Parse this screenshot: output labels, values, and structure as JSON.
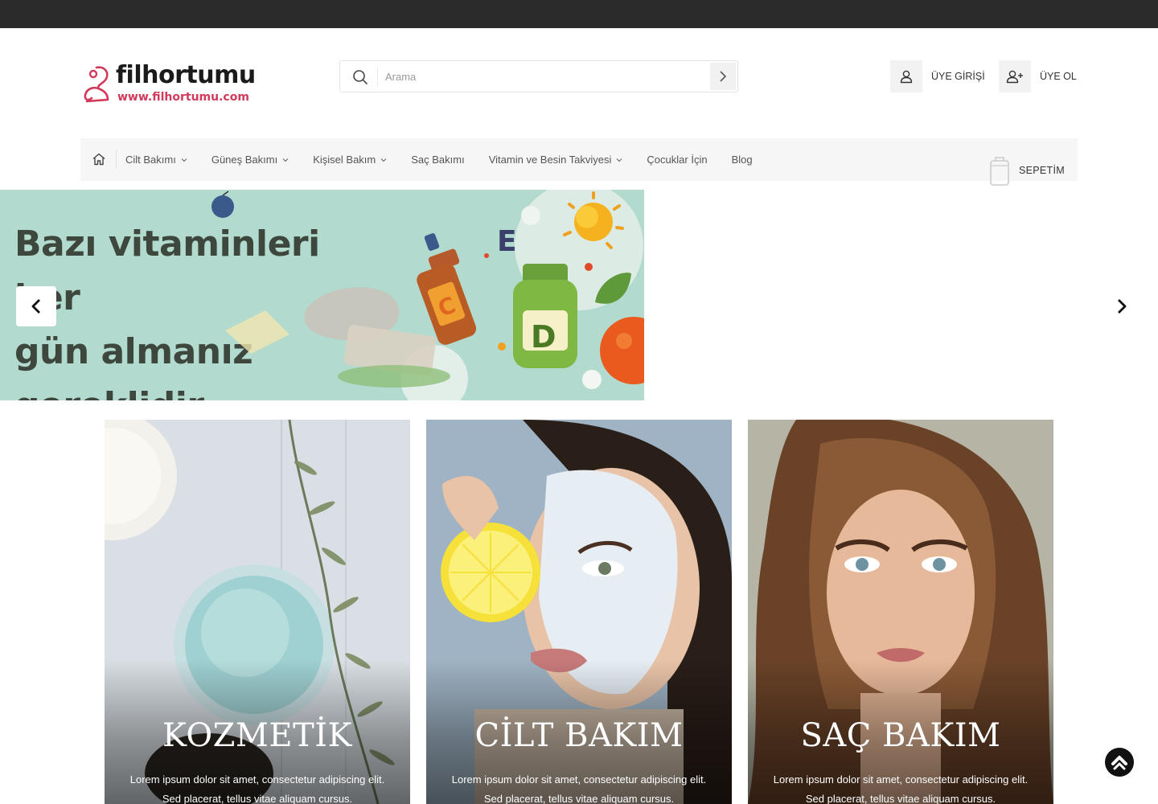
{
  "brand": {
    "name": "filhortumu",
    "url": "www.filhortumu.com",
    "color": "#d23a5c"
  },
  "search": {
    "placeholder": "Arama",
    "icon": "search-icon",
    "submit_icon": "chevron-right-icon"
  },
  "account": {
    "login_label": "ÜYE GİRİŞİ",
    "register_label": "ÜYE OL",
    "login_icon": "user-icon",
    "register_icon": "user-plus-icon"
  },
  "nav": {
    "home_icon": "home-icon",
    "items": [
      {
        "label": "Cilt Bakımı",
        "dropdown": true
      },
      {
        "label": "Güneş Bakımı",
        "dropdown": true
      },
      {
        "label": "Kişisel Bakım",
        "dropdown": true
      },
      {
        "label": "Saç Bakımı",
        "dropdown": false
      },
      {
        "label": "Vitamin ve Besin Takviyesi",
        "dropdown": true
      },
      {
        "label": "Çocuklar İçin",
        "dropdown": false
      },
      {
        "label": "Blog",
        "dropdown": false
      }
    ],
    "cart_label": "SEPETİM",
    "cart_icon": "shopping-bag-icon"
  },
  "slider": {
    "lines": [
      "Bazı vitaminleri her",
      "gün almanız",
      "gereklidir."
    ],
    "art_letters": [
      "E",
      "D",
      "C"
    ],
    "background": "#b2dace",
    "prev_icon": "chevron-left-icon",
    "next_icon": "chevron-right-icon"
  },
  "cards": [
    {
      "title": "KOZMETİK",
      "description": "Lorem ipsum dolor sit amet, consectetur adipiscing elit. Sed placerat, tellus vitae aliquam cursus."
    },
    {
      "title": "CİLT BAKIM",
      "description": "Lorem ipsum dolor sit amet, consectetur adipiscing elit. Sed placerat, tellus vitae aliquam cursus."
    },
    {
      "title": "SAÇ BAKIM",
      "description": "Lorem ipsum dolor sit amet, consectetur adipiscing elit. Sed placerat, tellus vitae aliquam cursus."
    }
  ],
  "scroll_top_icon": "arrow-up-icon"
}
